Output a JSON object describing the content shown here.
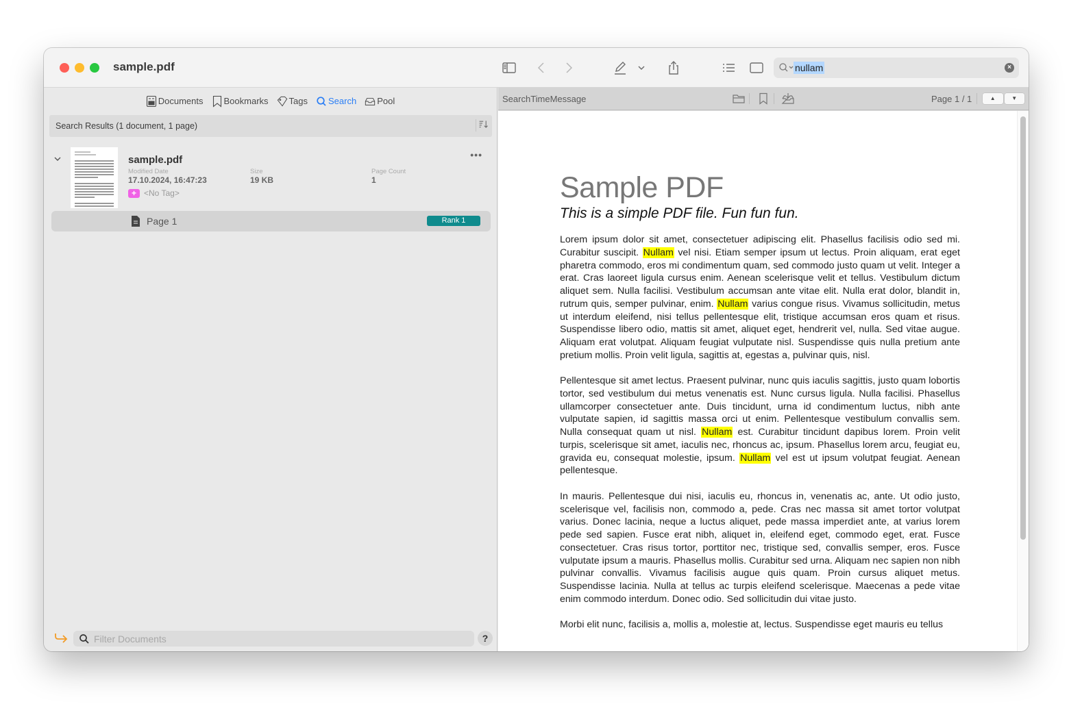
{
  "window": {
    "title": "sample.pdf"
  },
  "toolbar": {
    "search_query": "nullam",
    "icons": [
      "sidebar-icon",
      "back-icon",
      "forward-icon",
      "pencil-icon",
      "chevron-down-icon",
      "share-icon",
      "list-icon",
      "square-icon",
      "search-icon",
      "clear-icon"
    ]
  },
  "sidebar": {
    "tabs": [
      {
        "label": "Documents",
        "icon": "documents-icon",
        "active": false
      },
      {
        "label": "Bookmarks",
        "icon": "bookmark-icon",
        "active": false
      },
      {
        "label": "Tags",
        "icon": "tag-icon",
        "active": false
      },
      {
        "label": "Search",
        "icon": "search-icon",
        "active": true
      },
      {
        "label": "Pool",
        "icon": "tray-icon",
        "active": false
      }
    ],
    "results_header": "Search Results (1 document, 1 page)",
    "results": [
      {
        "name": "sample.pdf",
        "modified_label": "Modified Date",
        "modified_value": "17.10.2024, 16:47:23",
        "size_label": "Size",
        "size_value": "19 KB",
        "page_count_label": "Page Count",
        "page_count_value": "1",
        "tag": "<No Tag>",
        "more": "•••",
        "pages": [
          {
            "label": "Page 1",
            "rank": "Rank 1"
          }
        ]
      }
    ],
    "filter_placeholder": "Filter Documents",
    "help_label": "?"
  },
  "viewer": {
    "status_message": "SearchTimeMessage",
    "page_indicator": "Page 1 / 1",
    "prev_label": "▲",
    "next_label": "▼",
    "highlight_color": "#ffff00",
    "document": {
      "title": "Sample PDF",
      "subtitle": "This is a simple PDF file. Fun fun fun.",
      "paragraphs": [
        [
          {
            "t": "Lorem ipsum dolor sit amet, consectetuer adipiscing elit. Phasellus facilisis odio sed mi. Curabitur suscipit. "
          },
          {
            "t": "Nullam",
            "hl": true
          },
          {
            "t": " vel nisi. Etiam semper ipsum ut lectus. Proin aliquam, erat eget pharetra commodo, eros mi condimentum quam, sed commodo justo quam ut velit. Integer a erat. Cras laoreet ligula cursus enim. Aenean scelerisque velit et tellus. Vestibulum dictum aliquet sem. Nulla facilisi. Vestibulum accumsan ante vitae elit. Nulla erat dolor, blandit in, rutrum quis, semper pulvinar, enim. "
          },
          {
            "t": "Nullam",
            "hl": true
          },
          {
            "t": " varius congue risus. Vivamus sollicitudin, metus ut interdum eleifend, nisi tellus pellentesque elit, tristique accumsan eros quam et risus. Suspendisse libero odio, mattis sit amet, aliquet eget, hendrerit vel, nulla. Sed vitae augue. Aliquam erat volutpat. Aliquam feugiat vulputate nisl. Suspendisse quis nulla pretium ante pretium mollis. Proin velit ligula, sagittis at, egestas a, pulvinar quis, nisl."
          }
        ],
        [
          {
            "t": "Pellentesque sit amet lectus. Praesent pulvinar, nunc quis iaculis sagittis, justo quam lobortis tortor, sed vestibulum dui metus venenatis est. Nunc cursus ligula. Nulla facilisi. Phasellus ullamcorper consectetuer ante. Duis tincidunt, urna id condimentum luctus, nibh ante vulputate sapien, id sagittis massa orci ut enim. Pellentesque vestibulum convallis sem. Nulla consequat quam ut nisl. "
          },
          {
            "t": "Nullam",
            "hl": true
          },
          {
            "t": " est. Curabitur tincidunt dapibus lorem. Proin velit turpis, scelerisque sit amet, iaculis nec, rhoncus ac, ipsum. Phasellus lorem arcu, feugiat eu, gravida eu, consequat molestie, ipsum. "
          },
          {
            "t": "Nullam",
            "hl": true
          },
          {
            "t": " vel est ut ipsum volutpat feugiat. Aenean pellentesque."
          }
        ],
        [
          {
            "t": "In mauris. Pellentesque dui nisi, iaculis eu, rhoncus in, venenatis ac, ante. Ut odio justo, scelerisque vel, facilisis non, commodo a, pede. Cras nec massa sit amet tortor volutpat varius. Donec lacinia, neque a luctus aliquet, pede massa imperdiet ante, at varius lorem pede sed sapien. Fusce erat nibh, aliquet in, eleifend eget, commodo eget, erat. Fusce consectetuer. Cras risus tortor, porttitor nec, tristique sed, convallis semper, eros. Fusce vulputate ipsum a mauris. Phasellus mollis. Curabitur sed urna. Aliquam nec sapien non nibh pulvinar convallis. Vivamus facilisis augue quis quam. Proin cursus aliquet metus. Suspendisse lacinia. Nulla at tellus ac turpis eleifend scelerisque. Maecenas a pede vitae enim commodo interdum. Donec odio. Sed sollicitudin dui vitae justo."
          }
        ],
        [
          {
            "t": "Morbi elit nunc, facilisis a, mollis a, molestie at, lectus. Suspendisse eget mauris eu tellus"
          }
        ]
      ]
    }
  }
}
